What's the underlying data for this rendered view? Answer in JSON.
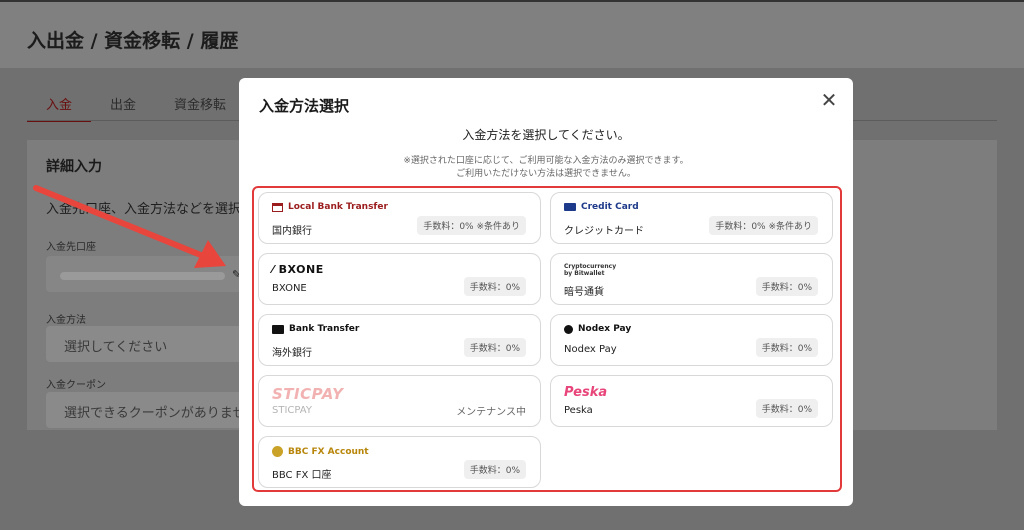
{
  "page": {
    "title": "入出金 / 資金移転 / 履歴",
    "tabs": [
      "入金",
      "出金",
      "資金移転"
    ],
    "card_title": "詳細入力",
    "card_desc": "入金先口座、入金方法などを選択",
    "fields": [
      {
        "label": "入金先口座",
        "value": ""
      },
      {
        "label": "入金方法",
        "value": "選択してください"
      },
      {
        "label": "入金クーポン",
        "value": "選択できるクーポンがありません"
      }
    ]
  },
  "modal": {
    "title": "入金方法選択",
    "heading": "入金方法を選択してください。",
    "note_line1": "※選択された口座に応じて、ご利用可能な入金方法のみ選択できます。",
    "note_line2": "ご利用いただけない方法は選択できません。",
    "options": [
      {
        "brand": "Local Bank Transfer",
        "brand_color": "#9b1c1c",
        "name": "国内銀行",
        "fee": "手数料：0% ※条件あり",
        "status": ""
      },
      {
        "brand": "Credit Card",
        "brand_color": "#1d3a8a",
        "name": "クレジットカード",
        "fee": "手数料：0% ※条件あり",
        "status": ""
      },
      {
        "brand": "BXONE",
        "brand_color": "#111111",
        "name": "BXONE",
        "fee": "手数料：0%",
        "status": ""
      },
      {
        "brand": "Cryptocurrency by Bitwallet",
        "brand_color": "#333333",
        "name": "暗号通貨",
        "fee": "手数料：0%",
        "status": ""
      },
      {
        "brand": "Bank Transfer",
        "brand_color": "#111111",
        "name": "海外銀行",
        "fee": "手数料：0%",
        "status": ""
      },
      {
        "brand": "Nodex Pay",
        "brand_color": "#111111",
        "name": "Nodex Pay",
        "fee": "手数料：0%",
        "status": ""
      },
      {
        "brand": "STICPAY",
        "brand_color": "#f2b2b2",
        "name": "STICPAY",
        "fee": "",
        "status": "メンテナンス中"
      },
      {
        "brand": "Peska",
        "brand_color": "#e8457a",
        "name": "Peska",
        "fee": "手数料：0%",
        "status": ""
      },
      {
        "brand": "BBC FX Account",
        "brand_color": "#b8860b",
        "name": "BBC FX 口座",
        "fee": "手数料：0%",
        "status": ""
      }
    ]
  }
}
